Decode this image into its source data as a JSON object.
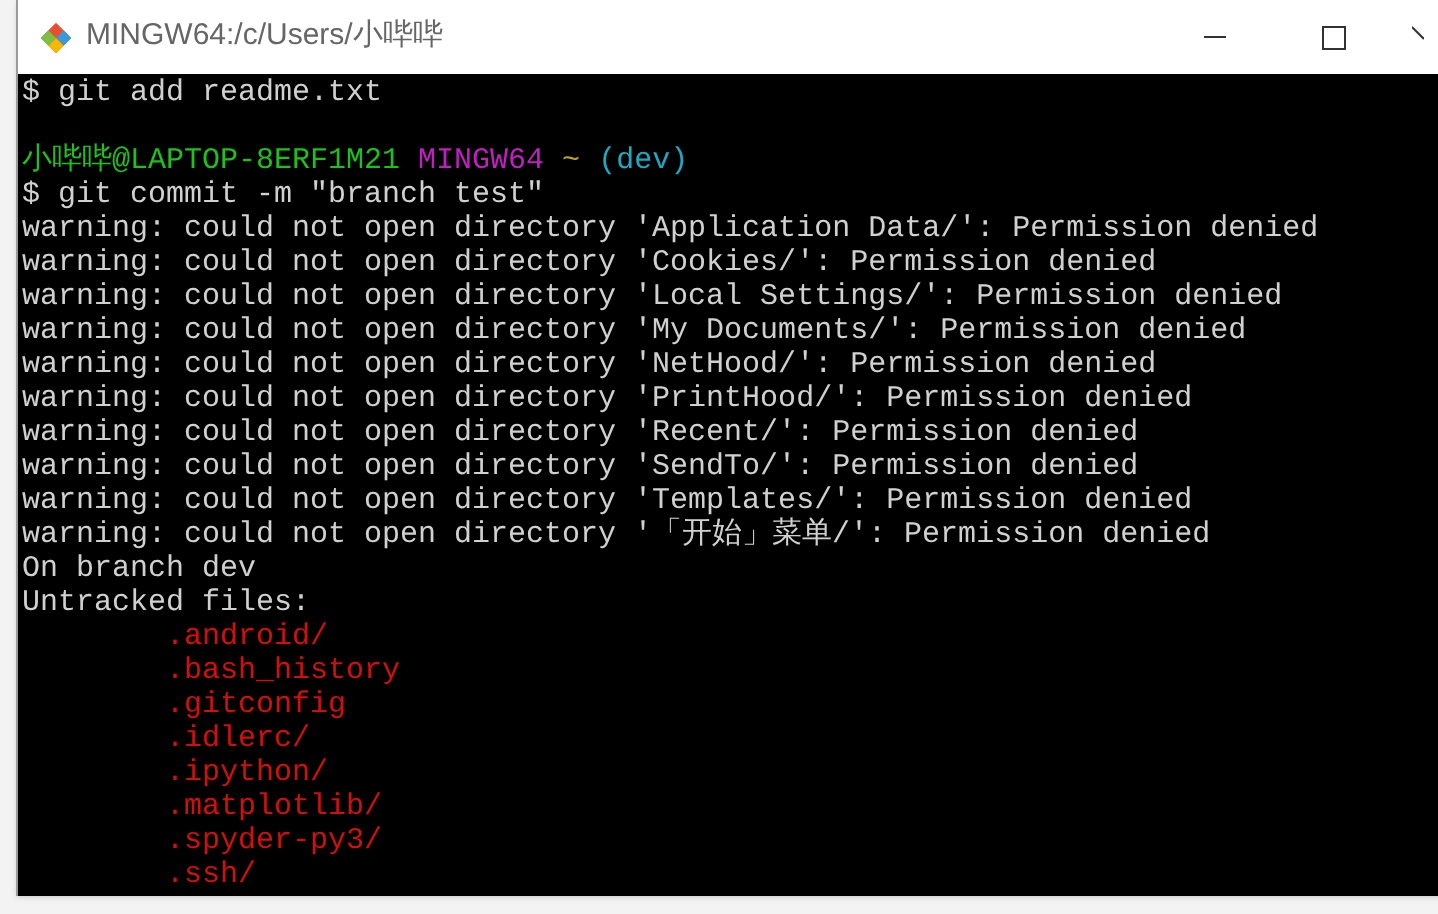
{
  "window": {
    "title": "MINGW64:/c/Users/小哔哔"
  },
  "lines": [
    {
      "kind": "command",
      "text": "$ git add readme.txt"
    },
    {
      "kind": "blank"
    },
    {
      "kind": "prompt",
      "user": "小哔哔@LAPTOP-8ERF1M21",
      "shell": "MINGW64",
      "path": "~",
      "branch": "(dev)"
    },
    {
      "kind": "command",
      "text": "$ git commit -m \"branch test\""
    },
    {
      "kind": "output",
      "text": "warning: could not open directory 'Application Data/': Permission denied"
    },
    {
      "kind": "output",
      "text": "warning: could not open directory 'Cookies/': Permission denied"
    },
    {
      "kind": "output",
      "text": "warning: could not open directory 'Local Settings/': Permission denied"
    },
    {
      "kind": "output",
      "text": "warning: could not open directory 'My Documents/': Permission denied"
    },
    {
      "kind": "output",
      "text": "warning: could not open directory 'NetHood/': Permission denied"
    },
    {
      "kind": "output",
      "text": "warning: could not open directory 'PrintHood/': Permission denied"
    },
    {
      "kind": "output",
      "text": "warning: could not open directory 'Recent/': Permission denied"
    },
    {
      "kind": "output",
      "text": "warning: could not open directory 'SendTo/': Permission denied"
    },
    {
      "kind": "output",
      "text": "warning: could not open directory 'Templates/': Permission denied"
    },
    {
      "kind": "output",
      "text": "warning: could not open directory '「开始」菜单/': Permission denied"
    },
    {
      "kind": "output",
      "text": "On branch dev"
    },
    {
      "kind": "output",
      "text": "Untracked files:"
    },
    {
      "kind": "untracked",
      "text": ".android/"
    },
    {
      "kind": "untracked",
      "text": ".bash_history"
    },
    {
      "kind": "untracked",
      "text": ".gitconfig"
    },
    {
      "kind": "untracked",
      "text": ".idlerc/"
    },
    {
      "kind": "untracked",
      "text": ".ipython/"
    },
    {
      "kind": "untracked",
      "text": ".matplotlib/"
    },
    {
      "kind": "untracked",
      "text": ".spyder-py3/"
    },
    {
      "kind": "untracked",
      "text": ".ssh/"
    }
  ]
}
